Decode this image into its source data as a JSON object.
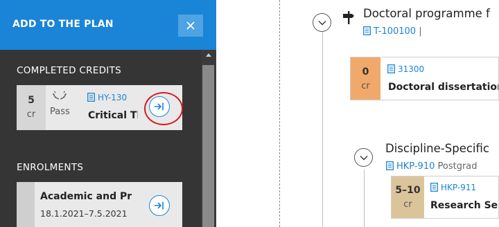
{
  "sidebar": {
    "title": "ADD TO THE PLAN",
    "close_icon": "close-icon",
    "completed_label": "COMPLETED CREDITS",
    "enrolments_label": "ENROLMENTS",
    "completed_card": {
      "credits": "5",
      "credits_unit": "cr",
      "grade_icon": "laurel-icon",
      "grade": "Pass",
      "code": "HY-130",
      "name": "Critical Thinking"
    },
    "enrolment_card": {
      "name": "Academic and Professional",
      "dates": "18.1.2021–7.5.2021"
    }
  },
  "plan": {
    "programme_title": "Doctoral programme f",
    "programme_code": "T-100100",
    "programme_sep": "|",
    "dissertation": {
      "credits": "0",
      "unit": "cr",
      "code": "31300",
      "name": "Doctoral dissertation"
    },
    "discipline_title": "Discipline-Specific",
    "discipline_code": "HKP-910",
    "discipline_suffix": "Postgrad",
    "research": {
      "credits": "5–10",
      "unit": "cr",
      "code": "HKP-911",
      "name": "Research Seminar"
    }
  },
  "colors": {
    "accent": "#1a84d6",
    "header": "#1a84d6",
    "sidebar_bg": "#353535",
    "dissertation_credit_bg": "#f0a96a",
    "research_credit_bg": "#dcc49a",
    "highlight": "#d71920"
  }
}
